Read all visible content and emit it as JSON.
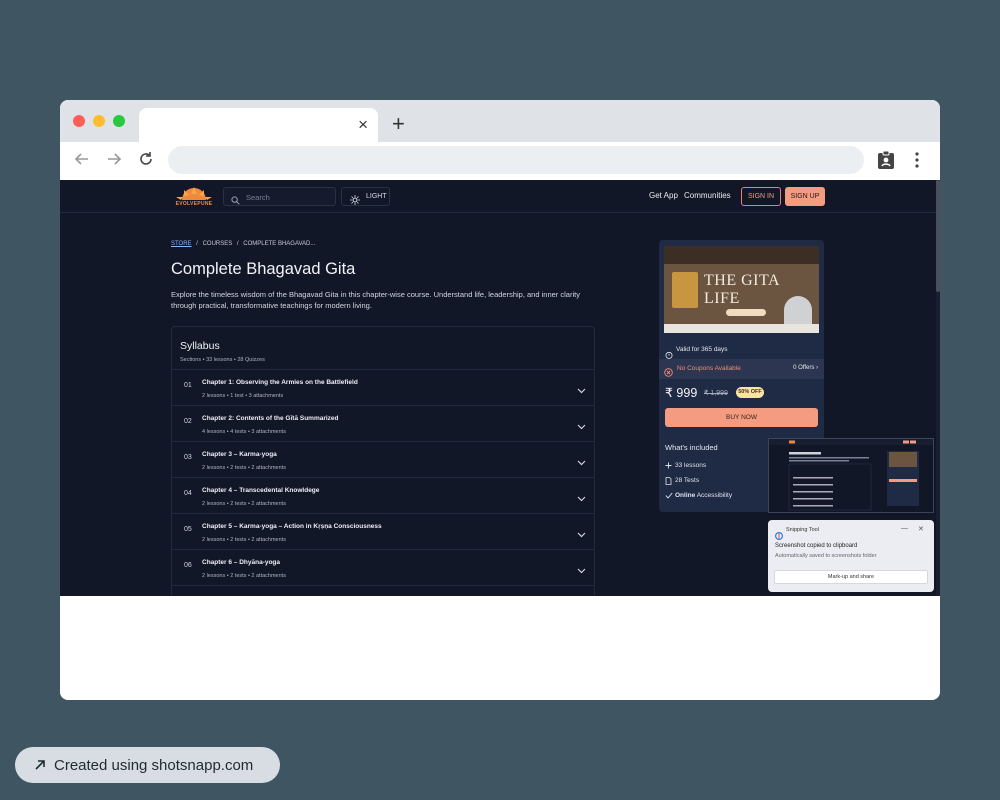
{
  "browser": {
    "tab_close": "×",
    "new_tab": "+"
  },
  "site": {
    "logo_text": "EVOLVEPUNE",
    "search_placeholder": "Search",
    "theme_toggle": "LIGHT",
    "nav": {
      "get_app": "Get App",
      "communities": "Communities"
    },
    "sign_in": "SIGN IN",
    "sign_up": "SIGN UP"
  },
  "breadcrumb": {
    "store": "STORE",
    "sep": "/",
    "courses": "COURSES",
    "current": "COMPLETE BHAGAVAD..."
  },
  "course": {
    "title": "Complete Bhagavad Gita",
    "description": "Explore the timeless wisdom of the Bhagavad Gita in this chapter-wise course. Understand life, leadership, and inner clarity through practical, transformative teachings for modern living."
  },
  "syllabus": {
    "title": "Syllabus",
    "meta": "Sections • 33 lessons • 28 Quizzes",
    "chapters": [
      {
        "num": "01",
        "title": "Chapter 1: Observing the Armies on the Battlefield",
        "meta": "2 lessons • 1 test • 3 attachments"
      },
      {
        "num": "02",
        "title": "Chapter 2: Contents of the Gītā Summarized",
        "meta": "4 lessons • 4 tests • 3 attachments"
      },
      {
        "num": "03",
        "title": "Chapter 3 – Karma-yoga",
        "meta": "2 lessons • 2 tests • 2 attachments"
      },
      {
        "num": "04",
        "title": "Chapter 4 – Transcedental Knowldege",
        "meta": "2 lessons • 2 tests • 2 attachments"
      },
      {
        "num": "05",
        "title": "Chapter 5 – Karma-yoga – Action in Kṛṣṇa Consciousness",
        "meta": "2 lessons • 2 tests • 2 attachments"
      },
      {
        "num": "06",
        "title": "Chapter 6 – Dhyāna-yoga",
        "meta": "2 lessons • 2 tests • 2 attachments"
      }
    ]
  },
  "card": {
    "banner_title": "THE GITA LIFE",
    "validity": "Valid for 365 days",
    "coupon_label": "No Coupons Available",
    "offers": "0 Offers",
    "price": "₹ 999",
    "mrp": "₹ 1,999",
    "discount": "50% OFF",
    "buy_now": "BUY NOW",
    "included_title": "What's included",
    "included": [
      {
        "icon": "plus-icon",
        "text": "33 lessons"
      },
      {
        "icon": "document-icon",
        "text": "28 Tests"
      },
      {
        "icon": "check-icon",
        "bold": "Online",
        "text": "Accessibility"
      }
    ]
  },
  "snipping_tool": {
    "app_name": "Snipping Tool",
    "minimize": "—",
    "close": "✕",
    "message": "Screenshot copied to clipboard",
    "sub_message": "Automatically saved to screenshots folder",
    "action": "Mark-up and share"
  },
  "watermark": {
    "text": "Created using shotsnapp.com"
  },
  "colors": {
    "page_background": "#3f5562",
    "site_background": "#121728",
    "accent": "#f39c82",
    "coupon_text": "#f28b7a",
    "link": "#8fb0ff"
  }
}
